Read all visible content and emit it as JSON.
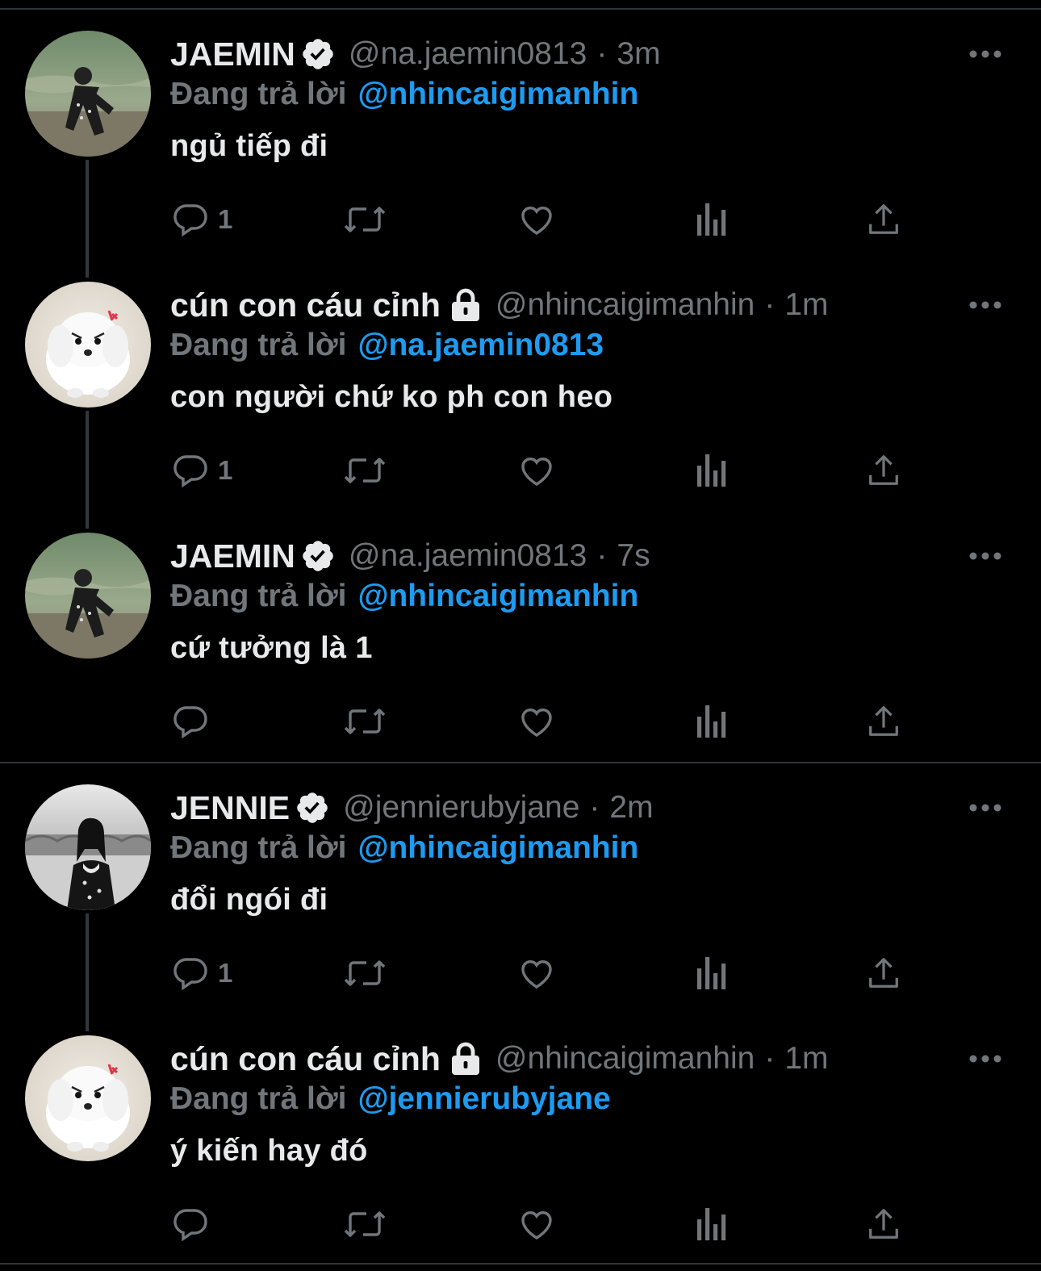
{
  "tweets": [
    {
      "name": "JAEMIN",
      "verified": true,
      "handle": "@na.jaemin0813",
      "dot": "·",
      "time": "3m",
      "reply_label": "Đang trả lời",
      "reply_to": "@nhincaigimanhin",
      "text": "ngủ tiếp đi",
      "reply_count": "1",
      "avatar": "jaemin-avatar"
    },
    {
      "name": "cún con cáu cỉnh",
      "locked": true,
      "handle": "@nhincaigimanhin",
      "dot": "·",
      "time": "1m",
      "reply_label": "Đang trả lời",
      "reply_to": "@na.jaemin0813",
      "text": "con người chứ ko ph con heo",
      "reply_count": "1",
      "avatar": "puppy-avatar"
    },
    {
      "name": "JAEMIN",
      "verified": true,
      "handle": "@na.jaemin0813",
      "dot": "·",
      "time": "7s",
      "reply_label": "Đang trả lời",
      "reply_to": "@nhincaigimanhin",
      "text": "cứ tưởng là 1",
      "reply_count": "",
      "avatar": "jaemin-avatar"
    },
    {
      "name": "JENNIE",
      "verified": true,
      "handle": "@jennierubyjane",
      "dot": "·",
      "time": "2m",
      "reply_label": "Đang trả lời",
      "reply_to": "@nhincaigimanhin",
      "text": "đổi ngói đi",
      "reply_count": "1",
      "avatar": "jennie-avatar"
    },
    {
      "name": "cún con cáu cỉnh",
      "locked": true,
      "handle": "@nhincaigimanhin",
      "dot": "·",
      "time": "1m",
      "reply_label": "Đang trả lời",
      "reply_to": "@jennierubyjane",
      "text": "ý kiến hay đó",
      "reply_count": "",
      "avatar": "puppy-avatar"
    }
  ],
  "colors": {
    "background": "#000000",
    "text": "#e7e9ea",
    "muted": "#71767b",
    "accent": "#1d9bf0",
    "divider": "#2f3336"
  },
  "icons": [
    "reply-icon",
    "retweet-icon",
    "like-icon",
    "views-icon",
    "share-icon",
    "more-icon",
    "verified-icon",
    "lock-icon"
  ]
}
